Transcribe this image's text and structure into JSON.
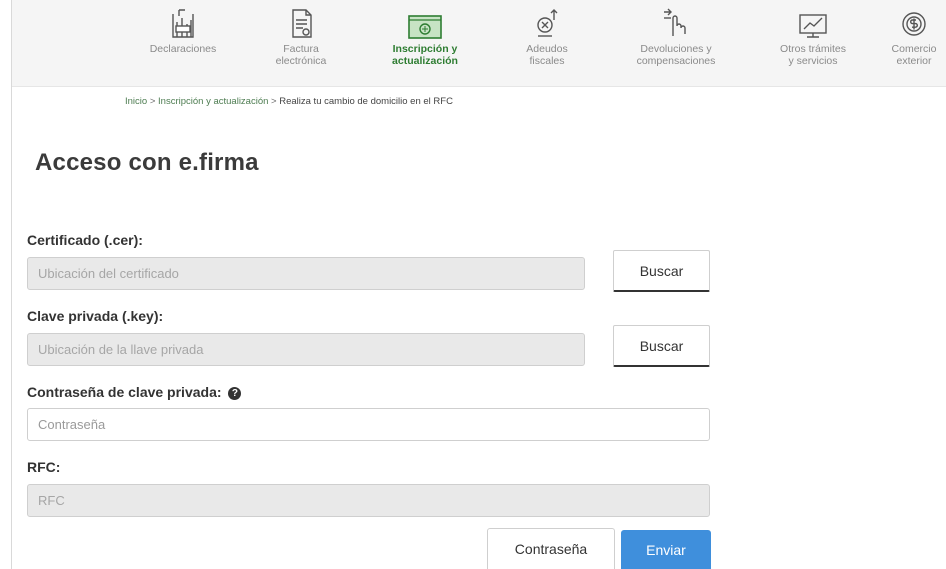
{
  "nav": {
    "items": [
      {
        "label": "Declaraciones",
        "icon": "declaraciones-icon",
        "active": false
      },
      {
        "label": "Factura\nelectrónica",
        "icon": "factura-icon",
        "active": false
      },
      {
        "label": "Inscripción y\nactualización",
        "icon": "inscripcion-icon",
        "active": true
      },
      {
        "label": "Adeudos\nfiscales",
        "icon": "adeudos-icon",
        "active": false
      },
      {
        "label": "Devoluciones y\ncompensaciones",
        "icon": "devoluciones-icon",
        "active": false
      },
      {
        "label": "Otros trámites\ny servicios",
        "icon": "otros-tramites-icon",
        "active": false
      },
      {
        "label": "Comercio\nexterior",
        "icon": "comercio-exterior-icon",
        "active": false
      }
    ]
  },
  "breadcrumb": {
    "home": "Inicio",
    "section": "Inscripción y actualización",
    "current": "Realiza tu cambio de domicilio en el RFC",
    "separator": ">"
  },
  "page_title": "Acceso con e.firma",
  "form": {
    "certificado": {
      "label": "Certificado (.cer):",
      "placeholder": "Ubicación del certificado",
      "value": "",
      "button": "Buscar"
    },
    "clave": {
      "label": "Clave privada (.key):",
      "placeholder": "Ubicación de la llave privada",
      "value": "",
      "button": "Buscar"
    },
    "contrasena": {
      "label": "Contraseña de clave privada:",
      "placeholder": "Contraseña",
      "value": "",
      "help_icon": "question-circle-icon"
    },
    "rfc": {
      "label": "RFC:",
      "placeholder": "RFC",
      "value": ""
    }
  },
  "actions": {
    "secondary": "Contraseña",
    "primary": "Enviar"
  },
  "colors": {
    "active_nav": "#2e7d32",
    "primary_button": "#3f8fdc",
    "breadcrumb_link": "#4e7d52"
  }
}
